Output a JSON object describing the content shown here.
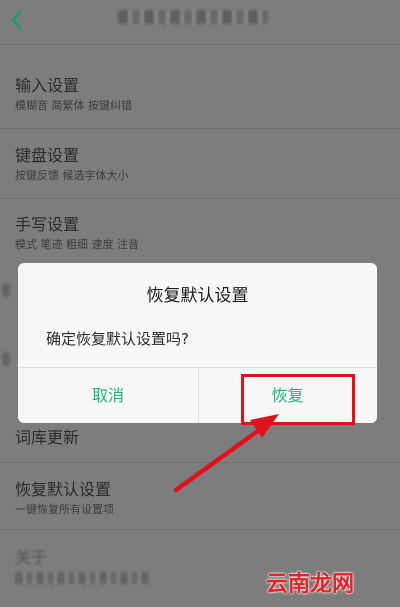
{
  "settings": {
    "items": [
      {
        "title": "输入设置",
        "subtitle": "模糊音 简繁体 按键纠错"
      },
      {
        "title": "键盘设置",
        "subtitle": "按键反馈 候选字体大小"
      },
      {
        "title": "手写设置",
        "subtitle": "模式 笔迹 粗细 速度 注音"
      },
      {
        "title": "词库更新"
      },
      {
        "title": "恢复默认设置",
        "subtitle": "一键恢复所有设置项"
      },
      {
        "title": "关于"
      }
    ]
  },
  "dialog": {
    "title": "恢复默认设置",
    "message": "确定恢复默认设置吗?",
    "cancel_label": "取消",
    "confirm_label": "恢复"
  },
  "watermark": "云南龙网",
  "colors": {
    "accent": "#20b47b",
    "annotation": "#e0131c",
    "overlay": "#7d7d7d"
  }
}
